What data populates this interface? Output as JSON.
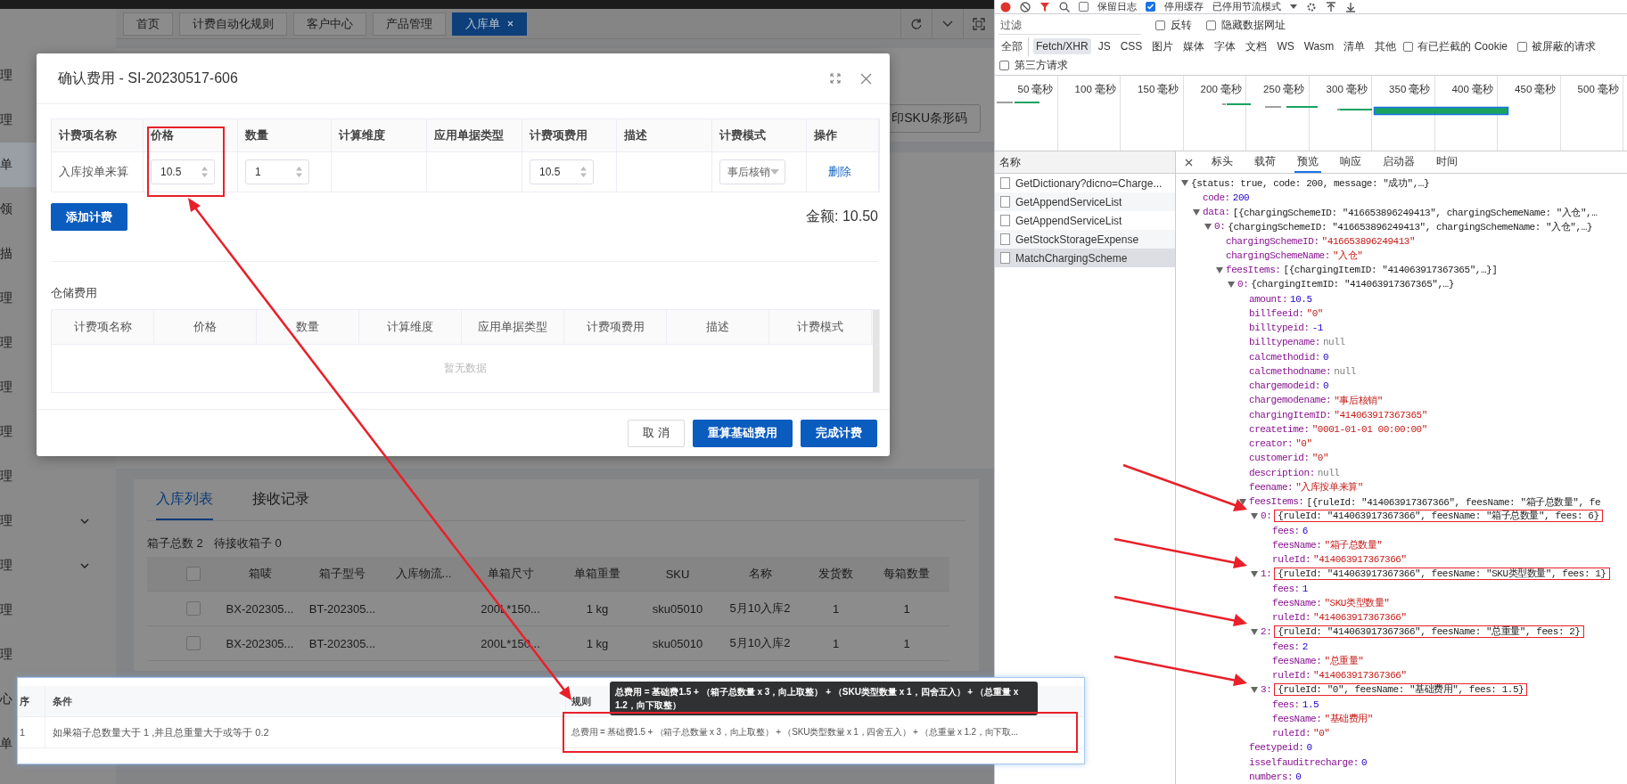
{
  "app": {
    "sidebar": {
      "items": [
        {
          "label": "理",
          "kind": "link",
          "selected": false
        },
        {
          "label": "理",
          "kind": "link",
          "selected": false
        },
        {
          "label": "单",
          "kind": "link",
          "selected": true
        },
        {
          "label": "领",
          "kind": "link",
          "selected": false
        },
        {
          "label": "描",
          "kind": "link",
          "selected": false
        },
        {
          "label": "理",
          "kind": "link",
          "selected": false
        },
        {
          "label": "理",
          "kind": "link",
          "selected": false
        },
        {
          "label": "理",
          "kind": "link",
          "selected": false
        },
        {
          "label": "理",
          "kind": "link",
          "selected": false
        },
        {
          "label": "理",
          "kind": "link",
          "selected": false
        },
        {
          "label": "理",
          "kind": "group",
          "selected": false
        },
        {
          "label": "理",
          "kind": "group",
          "selected": false
        },
        {
          "label": "理",
          "kind": "link",
          "selected": false
        },
        {
          "label": "理",
          "kind": "link",
          "selected": false
        },
        {
          "label": "心",
          "kind": "link",
          "selected": false
        },
        {
          "label": "单",
          "kind": "link",
          "selected": false
        }
      ]
    },
    "tabs": [
      {
        "label": "首页",
        "selected": false
      },
      {
        "label": "计费自动化规则",
        "selected": false
      },
      {
        "label": "客户中心",
        "selected": false
      },
      {
        "label": "产品管理",
        "selected": false
      },
      {
        "label": "入库单",
        "selected": true
      }
    ],
    "print_button": "印SKU条形码",
    "list_card": {
      "tabs": [
        {
          "label": "入库列表",
          "selected": true
        },
        {
          "label": "接收记录",
          "selected": false
        }
      ],
      "summary": [
        "箱子总数 2",
        "待接收箱子 0"
      ],
      "header_checked": false,
      "columns": [
        "箱唛",
        "箱子型号",
        "入库物流...",
        "单箱尺寸",
        "单箱重量",
        "SKU",
        "名称",
        "发货数",
        "每箱数量"
      ],
      "rows": [
        {
          "checked": false,
          "cells": [
            "BX-202305...",
            "BT-202305...",
            "",
            "200L*150...",
            "1 kg",
            "sku05010",
            "5月10入库2",
            "1",
            "1"
          ]
        },
        {
          "checked": false,
          "cells": [
            "BX-202305...",
            "BT-202305...",
            "",
            "200L*150...",
            "1 kg",
            "sku05010",
            "5月10入库2",
            "1",
            "1"
          ]
        }
      ]
    }
  },
  "dialog": {
    "title": "确认费用 - SI-20230517-606",
    "fee_table": {
      "columns": [
        "计费项名称",
        "价格",
        "数量",
        "计算维度",
        "应用单据类型",
        "计费项费用",
        "描述",
        "计费模式",
        "操作"
      ],
      "rows": [
        {
          "cells": [
            {
              "kind": "text",
              "value": "入库按单来算"
            },
            {
              "kind": "number",
              "value": "10.5"
            },
            {
              "kind": "number",
              "value": "1"
            },
            {
              "kind": "empty"
            },
            {
              "kind": "empty"
            },
            {
              "kind": "number",
              "value": "10.5"
            },
            {
              "kind": "empty"
            },
            {
              "kind": "select",
              "value": "事后核销"
            },
            {
              "kind": "link",
              "value": "删除"
            }
          ]
        }
      ]
    },
    "add_button": "添加计费",
    "total": "金额: 10.50",
    "storage": {
      "title": "仓储费用",
      "columns": [
        "计费项名称",
        "价格",
        "数量",
        "计算维度",
        "应用单据类型",
        "计费项费用",
        "描述",
        "计费模式"
      ],
      "empty_text": "暂无数据"
    },
    "footer_buttons": [
      {
        "label": "取 消",
        "kind": "default"
      },
      {
        "label": "重算基础费用",
        "kind": "primary"
      },
      {
        "label": "完成计费",
        "kind": "primary"
      }
    ]
  },
  "rule_panel": {
    "columns": [
      "序",
      "条件",
      "规则"
    ],
    "rows": [
      {
        "index": "1",
        "condition": "如果箱子总数量大于 1 ,并且总重量大于或等于 0.2",
        "rule": "总费用 = 基础费1.5 + （箱子总数量 x 3，向上取整） + （SKU类型数量 x 1，四舍五入） + （总重量 x 1.2，向下取..."
      }
    ],
    "tooltip": "总费用 = 基础费1.5 + （箱子总数量 x 3，向上取整） + （SKU类型数量 x 1，四舍五入） + （总重量 x 1.2，向下取整）"
  },
  "devtools": {
    "toolbar": {
      "checkboxes": [
        {
          "label": "保留日志",
          "checked": false
        },
        {
          "label": "停用缓存",
          "checked": true
        }
      ],
      "throttle": "已停用节流模式"
    },
    "filter": {
      "placeholder": "过滤",
      "checkboxes": [
        {
          "label": "反转",
          "checked": false
        },
        {
          "label": "隐藏数据网址",
          "checked": false
        }
      ]
    },
    "types": [
      {
        "label": "全部",
        "selected": false
      },
      {
        "label": "Fetch/XHR",
        "selected": true
      },
      {
        "label": "JS",
        "selected": false
      },
      {
        "label": "CSS",
        "selected": false
      },
      {
        "label": "图片",
        "selected": false
      },
      {
        "label": "媒体",
        "selected": false
      },
      {
        "label": "字体",
        "selected": false
      },
      {
        "label": "文档",
        "selected": false
      },
      {
        "label": "WS",
        "selected": false
      },
      {
        "label": "Wasm",
        "selected": false
      },
      {
        "label": "清单",
        "selected": false
      },
      {
        "label": "其他",
        "selected": false
      }
    ],
    "type_checkboxes": [
      {
        "label": "有已拦截的 Cookie",
        "checked": false
      },
      {
        "label": "被屏蔽的请求",
        "checked": false
      }
    ],
    "third_party": {
      "label": "第三方请求",
      "checked": false
    },
    "timeline": {
      "ticks": [
        "50 毫秒",
        "100 毫秒",
        "150 毫秒",
        "200 毫秒",
        "250 毫秒",
        "300 毫秒",
        "350 毫秒",
        "400 毫秒",
        "450 毫秒",
        "500 毫秒"
      ]
    },
    "requests": {
      "header": "名称",
      "items": [
        {
          "name": "GetDictionary?dicno=Charge...",
          "selected": false
        },
        {
          "name": "GetAppendServiceList",
          "selected": false
        },
        {
          "name": "GetAppendServiceList",
          "selected": false
        },
        {
          "name": "GetStockStorageExpense",
          "selected": false
        },
        {
          "name": "MatchChargingScheme",
          "selected": true
        }
      ]
    },
    "detail_tabs": [
      {
        "label": "标头",
        "selected": false
      },
      {
        "label": "载荷",
        "selected": false
      },
      {
        "label": "预览",
        "selected": true
      },
      {
        "label": "响应",
        "selected": false
      },
      {
        "label": "启动器",
        "selected": false
      },
      {
        "label": "时间",
        "selected": false
      }
    ],
    "preview": {
      "tree": [
        {
          "value": "{status: true, code: 200, message: \"成功\",…}",
          "kind": "summary",
          "expanded": true,
          "children": [
            {
              "key": "code:",
              "value": "200",
              "kind": "number"
            },
            {
              "key": "data:",
              "value": "[{chargingSchemeID: \"416653896249413\", chargingSchemeName: \"入仓\",…",
              "kind": "summary",
              "expanded": true,
              "children": [
                {
                  "key": "0:",
                  "value": "{chargingSchemeID: \"416653896249413\", chargingSchemeName: \"入仓\",…}",
                  "kind": "summary",
                  "expanded": true,
                  "children": [
                    {
                      "key": "chargingSchemeID:",
                      "value": "\"416653896249413\"",
                      "kind": "string"
                    },
                    {
                      "key": "chargingSchemeName:",
                      "value": "\"入仓\"",
                      "kind": "string"
                    },
                    {
                      "key": "feesItems:",
                      "value": "[{chargingItemID: \"414063917367365\",…}]",
                      "kind": "summary",
                      "expanded": true,
                      "children": [
                        {
                          "key": "0:",
                          "value": "{chargingItemID: \"414063917367365\",…}",
                          "kind": "summary",
                          "expanded": true,
                          "children": [
                            {
                              "key": "amount:",
                              "value": "10.5",
                              "kind": "number"
                            },
                            {
                              "key": "billfeeid:",
                              "value": "\"0\"",
                              "kind": "string"
                            },
                            {
                              "key": "billtypeid:",
                              "value": "-1",
                              "kind": "number"
                            },
                            {
                              "key": "billtypename:",
                              "value": "null",
                              "kind": "null"
                            },
                            {
                              "key": "calcmethodid:",
                              "value": "0",
                              "kind": "number"
                            },
                            {
                              "key": "calcmethodname:",
                              "value": "null",
                              "kind": "null"
                            },
                            {
                              "key": "chargemodeid:",
                              "value": "0",
                              "kind": "number"
                            },
                            {
                              "key": "chargemodename:",
                              "value": "\"事后核销\"",
                              "kind": "string"
                            },
                            {
                              "key": "chargingItemID:",
                              "value": "\"414063917367365\"",
                              "kind": "string"
                            },
                            {
                              "key": "createtime:",
                              "value": "\"0001-01-01 00:00:00\"",
                              "kind": "string"
                            },
                            {
                              "key": "creator:",
                              "value": "\"0\"",
                              "kind": "string"
                            },
                            {
                              "key": "customerid:",
                              "value": "\"0\"",
                              "kind": "string"
                            },
                            {
                              "key": "description:",
                              "value": "null",
                              "kind": "null"
                            },
                            {
                              "key": "feename:",
                              "value": "\"入库按单来算\"",
                              "kind": "string"
                            },
                            {
                              "key": "feesItems:",
                              "value": "[{ruleId: \"414063917367366\", feesName: \"箱子总数量\", fe",
                              "kind": "summary",
                              "expanded": true,
                              "children": [
                                {
                                  "key": "0:",
                                  "value": "{ruleId: \"414063917367366\", feesName: \"箱子总数量\", fees: 6}",
                                  "kind": "summary",
                                  "highlighted": true,
                                  "expanded": true,
                                  "children": [
                                    {
                                      "key": "fees:",
                                      "value": "6",
                                      "kind": "number"
                                    },
                                    {
                                      "key": "feesName:",
                                      "value": "\"箱子总数量\"",
                                      "kind": "string"
                                    },
                                    {
                                      "key": "ruleId:",
                                      "value": "\"414063917367366\"",
                                      "kind": "string"
                                    }
                                  ]
                                },
                                {
                                  "key": "1:",
                                  "value": "{ruleId: \"414063917367366\", feesName: \"SKU类型数量\", fees: 1}",
                                  "kind": "summary",
                                  "highlighted": true,
                                  "expanded": true,
                                  "children": [
                                    {
                                      "key": "fees:",
                                      "value": "1",
                                      "kind": "number"
                                    },
                                    {
                                      "key": "feesName:",
                                      "value": "\"SKU类型数量\"",
                                      "kind": "string"
                                    },
                                    {
                                      "key": "ruleId:",
                                      "value": "\"414063917367366\"",
                                      "kind": "string"
                                    }
                                  ]
                                },
                                {
                                  "key": "2:",
                                  "value": "{ruleId: \"414063917367366\", feesName: \"总重量\", fees: 2}",
                                  "kind": "summary",
                                  "highlighted": true,
                                  "expanded": true,
                                  "children": [
                                    {
                                      "key": "fees:",
                                      "value": "2",
                                      "kind": "number"
                                    },
                                    {
                                      "key": "feesName:",
                                      "value": "\"总重量\"",
                                      "kind": "string"
                                    },
                                    {
                                      "key": "ruleId:",
                                      "value": "\"414063917367366\"",
                                      "kind": "string"
                                    }
                                  ]
                                },
                                {
                                  "key": "3:",
                                  "value": "{ruleId: \"0\", feesName: \"基础费用\", fees: 1.5}",
                                  "kind": "summary",
                                  "highlighted": true,
                                  "expanded": true,
                                  "children": [
                                    {
                                      "key": "fees:",
                                      "value": "1.5",
                                      "kind": "number"
                                    },
                                    {
                                      "key": "feesName:",
                                      "value": "\"基础费用\"",
                                      "kind": "string"
                                    },
                                    {
                                      "key": "ruleId:",
                                      "value": "\"0\"",
                                      "kind": "string"
                                    }
                                  ]
                                }
                              ]
                            },
                            {
                              "key": "feetypeid:",
                              "value": "0",
                              "kind": "number"
                            },
                            {
                              "key": "isselfauditrecharge:",
                              "value": "0",
                              "kind": "number"
                            },
                            {
                              "key": "numbers:",
                              "value": "0",
                              "kind": "number"
                            }
                          ]
                        }
                      ]
                    }
                  ]
                }
              ]
            }
          ]
        }
      ]
    }
  }
}
